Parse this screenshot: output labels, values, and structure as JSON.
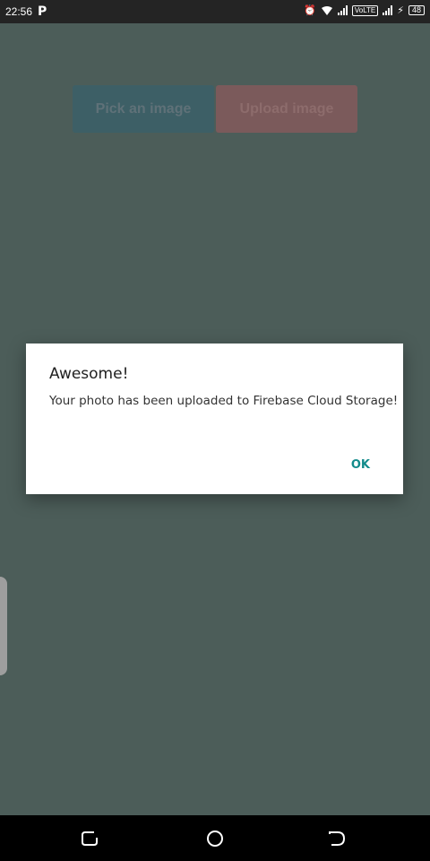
{
  "status_bar": {
    "time": "22:56",
    "notification_icon": "P",
    "alarm_icon": "alarm-icon",
    "wifi_icon": "wifi-icon",
    "volte_label": "VoLTE",
    "charging_icon": "⚡",
    "battery_level": "48"
  },
  "main": {
    "pick_button_label": "Pick an image",
    "upload_button_label": "Upload image"
  },
  "dialog": {
    "title": "Awesome!",
    "message": "Your photo has been uploaded to Firebase Cloud Storage!",
    "ok_label": "OK"
  },
  "nav_bar": {
    "recent_icon": "recent-apps-icon",
    "home_icon": "home-icon",
    "back_icon": "back-icon"
  },
  "colors": {
    "scrim_background": "#4c5d59",
    "dialog_accent": "#138b8b",
    "pick_button": "#3d5f66",
    "upload_button": "#7b5a5b"
  }
}
